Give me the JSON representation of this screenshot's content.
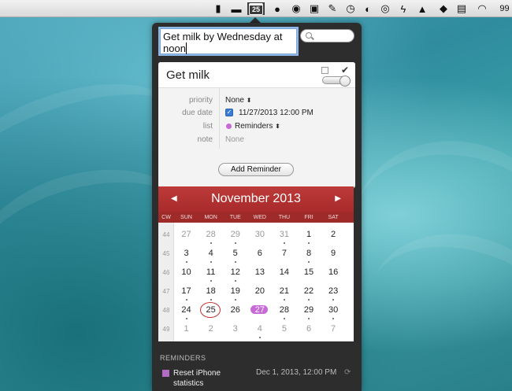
{
  "menubar": {
    "calendar_day": "25",
    "battery": "99"
  },
  "quick_entry": {
    "value": "Get milk by Wednesday at noon",
    "line1": "Get milk by Wednesday at",
    "line2": "noon"
  },
  "detail": {
    "title": "Get milk",
    "fields": {
      "priority_label": "priority",
      "priority_value": "None",
      "due_label": "due date",
      "due_value": "11/27/2013 12:00 PM",
      "due_checked": true,
      "list_label": "list",
      "list_value": "Reminders",
      "note_label": "note",
      "note_placeholder": "None"
    },
    "add_button": "Add Reminder"
  },
  "calendar": {
    "month": "November 2013",
    "cw_header": "CW",
    "days_of_week": [
      "SUN",
      "MON",
      "TUE",
      "WED",
      "THU",
      "FRI",
      "SAT"
    ],
    "weeks": [
      {
        "cw": "44",
        "days": [
          [
            "27",
            "o",
            0
          ],
          [
            "28",
            "o",
            1
          ],
          [
            "29",
            "o",
            1
          ],
          [
            "30",
            "o",
            0
          ],
          [
            "31",
            "o",
            1
          ],
          [
            "1",
            "",
            1
          ],
          [
            "2",
            "",
            0
          ]
        ]
      },
      {
        "cw": "45",
        "days": [
          [
            "3",
            "",
            1
          ],
          [
            "4",
            "",
            1
          ],
          [
            "5",
            "",
            1
          ],
          [
            "6",
            "",
            0
          ],
          [
            "7",
            "",
            0
          ],
          [
            "8",
            "",
            1
          ],
          [
            "9",
            "",
            0
          ]
        ]
      },
      {
        "cw": "46",
        "days": [
          [
            "10",
            "",
            0
          ],
          [
            "11",
            "",
            1
          ],
          [
            "12",
            "",
            1
          ],
          [
            "13",
            "",
            0
          ],
          [
            "14",
            "",
            0
          ],
          [
            "15",
            "",
            0
          ],
          [
            "16",
            "",
            0
          ]
        ]
      },
      {
        "cw": "47",
        "days": [
          [
            "17",
            "",
            1
          ],
          [
            "18",
            "",
            1
          ],
          [
            "19",
            "",
            1
          ],
          [
            "20",
            "",
            0
          ],
          [
            "21",
            "",
            1
          ],
          [
            "22",
            "",
            1
          ],
          [
            "23",
            "",
            1
          ]
        ]
      },
      {
        "cw": "48",
        "days": [
          [
            "24",
            "",
            1
          ],
          [
            "25",
            "t",
            0
          ],
          [
            "26",
            "",
            0
          ],
          [
            "27",
            "s",
            0
          ],
          [
            "28",
            "",
            1
          ],
          [
            "29",
            "",
            1
          ],
          [
            "30",
            "",
            1
          ]
        ]
      },
      {
        "cw": "49",
        "days": [
          [
            "1",
            "o",
            0
          ],
          [
            "2",
            "o",
            0
          ],
          [
            "3",
            "o",
            0
          ],
          [
            "4",
            "o",
            1
          ],
          [
            "5",
            "o",
            0
          ],
          [
            "6",
            "o",
            0
          ],
          [
            "7",
            "o",
            0
          ]
        ]
      }
    ]
  },
  "reminders": {
    "heading": "REMINDERS",
    "items": [
      {
        "title": "Reset iPhone statistics",
        "date": "Dec 1, 2013, 12:00 PM",
        "color": "#b36cc4"
      }
    ]
  },
  "colors": {
    "calendar_header": "#b03131",
    "selected_day": "#c769d6",
    "today_ring": "#c53030"
  }
}
